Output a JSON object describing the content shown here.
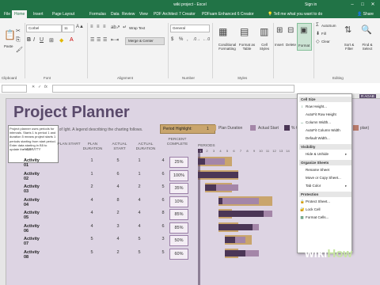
{
  "window": {
    "title": "wiki project - Excel",
    "sign_in": "Sign in"
  },
  "tabs": [
    "File",
    "Home",
    "Insert",
    "Page Layout",
    "Formulas",
    "Data",
    "Review",
    "View",
    "PDF Architect 7 Creator",
    "PDFsam Enhanced 6 Creator"
  ],
  "tell_me": "Tell me what you want to do",
  "share": "Share",
  "ribbon": {
    "paste": "Paste",
    "font_name": "Corbel",
    "font_size": "11",
    "wrap_text": "Wrap Text",
    "merge_center": "Merge & Center",
    "number_format": "General",
    "conditional_formatting": "Conditional Formatting",
    "format_as_table": "Format as Table",
    "cell_styles": "Cell Styles",
    "insert": "Insert",
    "delete": "Delete",
    "format": "Format",
    "autosum": "AutoSum",
    "fill": "Fill",
    "clear": "Clear",
    "sort_filter": "Sort & Filter",
    "find_select": "Find & Select",
    "groups": [
      "Clipboard",
      "Font",
      "Alignment",
      "Number",
      "Styles",
      "Editing"
    ]
  },
  "sheet": {
    "title": "Project Planner",
    "subtitle": "t of Ight. A legend describing the charting follows.",
    "period_highlight_label": "Period Highlight:",
    "period_highlight_value": "1",
    "legend": [
      "Plan Duration",
      "Actual Start",
      "% C",
      "plan)"
    ],
    "headers": [
      "ACTIVITY",
      "PLAN START",
      "PLAN DURATION",
      "ACTUAL START",
      "ACTUAL DURATION",
      "PERCENT COMPLETE",
      "PERIODS"
    ],
    "periods_row": "1 2 3 4 5 6 7 8 9 10 11 12 13 14",
    "tooltip": "Project planner uses periods for intervals. Starts 1 is period 1 and duration 5 means project starts 1 periods starting from start period. Enter data starting in B5 to update the chart",
    "rows": [
      {
        "activity": "Activity 01",
        "plan_start": "1",
        "plan_duration": "5",
        "actual_start": "1",
        "actual_duration": "4",
        "percent": "25%"
      },
      {
        "activity": "Activity 02",
        "plan_start": "1",
        "plan_duration": "6",
        "actual_start": "1",
        "actual_duration": "6",
        "percent": "100%"
      },
      {
        "activity": "Activity 03",
        "plan_start": "2",
        "plan_duration": "4",
        "actual_start": "2",
        "actual_duration": "5",
        "percent": "35%"
      },
      {
        "activity": "Activity 04",
        "plan_start": "4",
        "plan_duration": "8",
        "actual_start": "4",
        "actual_duration": "6",
        "percent": "10%"
      },
      {
        "activity": "Activity 05",
        "plan_start": "4",
        "plan_duration": "2",
        "actual_start": "4",
        "actual_duration": "8",
        "percent": "85%"
      },
      {
        "activity": "Activity 06",
        "plan_start": "4",
        "plan_duration": "3",
        "actual_start": "4",
        "actual_duration": "6",
        "percent": "85%"
      },
      {
        "activity": "Activity 07",
        "plan_start": "5",
        "plan_duration": "4",
        "actual_start": "5",
        "actual_duration": "3",
        "percent": "50%"
      },
      {
        "activity": "Activity 08",
        "plan_start": "5",
        "plan_duration": "2",
        "actual_start": "5",
        "actual_duration": "5",
        "percent": "60%"
      }
    ],
    "right_cut_text": "R AGAB"
  },
  "format_menu": {
    "sections": [
      "Cell Size",
      "Visibility",
      "Organize Sheets",
      "Protection"
    ],
    "cell_size": [
      "Row Height...",
      "AutoFit Row Height",
      "Column Width...",
      "AutoFit Column Width",
      "Default Width..."
    ],
    "visibility": [
      "Hide & Unhide"
    ],
    "organize": [
      "Rename Sheet",
      "Move or Copy Sheet...",
      "Tab Color"
    ],
    "protection": [
      "Protect Sheet...",
      "Lock Cell",
      "Format Cells..."
    ]
  },
  "watermark": {
    "wiki": "wiki",
    "how": "How"
  },
  "colors": {
    "excel_green": "#217346",
    "sheet_bg": "#ddd4e3",
    "title_purple": "#5a4a6b",
    "bar_dark": "#4b3656",
    "bar_tan": "#c9a56d",
    "bar_mauve": "#a486a8"
  }
}
